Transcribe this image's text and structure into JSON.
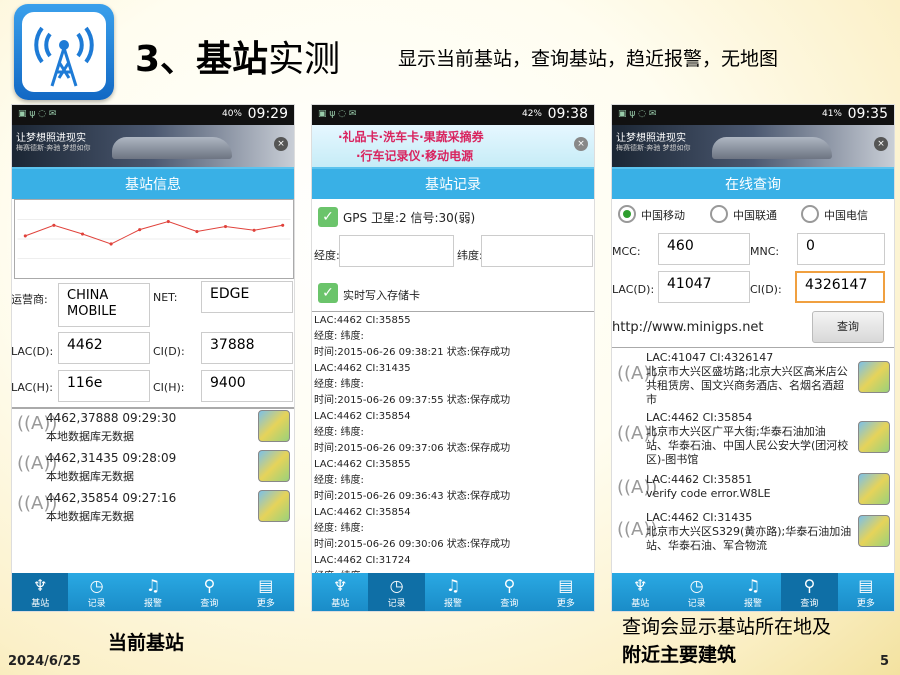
{
  "slide": {
    "title_number": "3、基站",
    "title_suffix": "实测",
    "subtitle": "显示当前基站，查询基站，趋近报警，无地图",
    "caption_left": "当前基站",
    "caption_right_1": "查询会显示基站所在地及",
    "caption_right_2": "附近主要建筑",
    "date": "2024/6/25",
    "page_number": "5"
  },
  "phones": [
    {
      "battery": "40%",
      "time": "09:29",
      "header": "基站信息"
    },
    {
      "battery": "42%",
      "time": "09:38",
      "header": "基站记录"
    },
    {
      "battery": "41%",
      "time": "09:35",
      "header": "在线查询"
    }
  ],
  "ads": {
    "car_line1": "让梦想照进现实",
    "car_line2": "梅赛德斯·奔驰 梦想如你",
    "car_brand": "Mercedes-Benz",
    "promo_line1": "·礼品卡·洗车卡·果蔬采摘券",
    "promo_line2": "·行车记录仪·移动电源"
  },
  "info": {
    "operator_label": "运营商:",
    "operator_value": "CHINA MOBILE",
    "net_label": "NET:",
    "net_value": "EDGE",
    "lacd_label": "LAC(D):",
    "lacd_value": "4462",
    "cid_label": "CI(D):",
    "cid_value": "37888",
    "lach_label": "LAC(H):",
    "lach_value": "116e",
    "cih_label": "CI(H):",
    "cih_value": "9400",
    "items": [
      {
        "line1": "4462,37888  09:29:30",
        "line2": "本地数据库无数据"
      },
      {
        "line1": "4462,31435  09:28:09",
        "line2": "本地数据库无数据"
      },
      {
        "line1": "4462,35854  09:27:16",
        "line2": "本地数据库无数据"
      }
    ]
  },
  "chart_data": {
    "type": "line",
    "title": "",
    "xlabel": "",
    "ylabel": "",
    "series": [
      {
        "values": [
          0.55,
          0.72,
          0.58,
          0.42,
          0.65,
          0.78,
          0.62,
          0.7,
          0.64,
          0.72
        ]
      }
    ],
    "ylim": [
      0,
      1
    ],
    "color": "#e0423b"
  },
  "records": {
    "gps_label": "GPS  卫星:2 信号:30(弱)",
    "lng_label": "经度:",
    "lat_label": "纬度:",
    "sd_label": "实时写入存储卡",
    "entries": [
      {
        "line1": "LAC:4462 CI:35855",
        "line2": "经度: 纬度:",
        "line3": "时间:2015-06-26 09:38:21 状态:保存成功"
      },
      {
        "line1": "LAC:4462 CI:31435",
        "line2": "经度: 纬度:",
        "line3": "时间:2015-06-26 09:37:55 状态:保存成功"
      },
      {
        "line1": "LAC:4462 CI:35854",
        "line2": "经度: 纬度:",
        "line3": "时间:2015-06-26 09:37:06 状态:保存成功"
      },
      {
        "line1": "LAC:4462 CI:35855",
        "line2": "经度: 纬度:",
        "line3": "时间:2015-06-26 09:36:43 状态:保存成功"
      },
      {
        "line1": "LAC:4462 CI:35854",
        "line2": "经度: 纬度:",
        "line3": "时间:2015-06-26 09:30:06 状态:保存成功"
      },
      {
        "line1": "LAC:4462 CI:31724",
        "line2": "经度: 纬度:",
        "line3": ""
      }
    ]
  },
  "query": {
    "carrier1": "中国移动",
    "carrier2": "中国联通",
    "carrier3": "中国电信",
    "mcc_label": "MCC:",
    "mcc_value": "460",
    "mnc_label": "MNC:",
    "mnc_value": "0",
    "lac_label": "LAC(D):",
    "lac_value": "41047",
    "ci_label": "CI(D):",
    "ci_value": "4326147",
    "url": "http://www.minigps.net",
    "button": "查询",
    "results": [
      {
        "line1": "LAC:41047 CI:4326147",
        "line2": "北京市大兴区盛坊路;北京大兴区高米店公",
        "line3": "共租赁房、国文兴商务酒店、名烟名酒超",
        "line4": "市"
      },
      {
        "line1": "LAC:4462 CI:35854",
        "line2": "北京市大兴区广平大街;华泰石油加油",
        "line3": "站、华泰石油、中国人民公安大学(团河校",
        "line4": "区)-图书馆"
      },
      {
        "line1": "LAC:4462 CI:35851",
        "line2": "verify code error.W8LE",
        "line3": "",
        "line4": ""
      },
      {
        "line1": "LAC:4462 CI:31435",
        "line2": "北京市大兴区S329(黄亦路);华泰石油加油",
        "line3": "站、华泰石油、军合物流",
        "line4": ""
      }
    ]
  },
  "tabbar": {
    "t1": "基站",
    "t2": "记录",
    "t3": "报警",
    "t4": "查询",
    "t5": "更多"
  },
  "colors": {
    "header": "#39b0e6",
    "tabbar": "#1a8cc8",
    "accent_green": "#6bc46b"
  }
}
